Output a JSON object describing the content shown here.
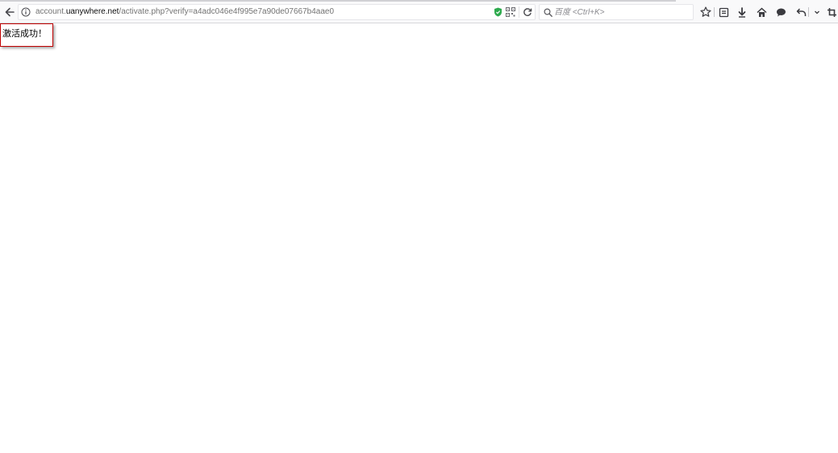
{
  "browser": {
    "url": {
      "prefix": "account.",
      "host": "uanywhere.net",
      "path": "/activate.php?verify=a4adc046e4f995e7a90de07667b4aae0"
    },
    "search": {
      "placeholder": "百度 <Ctrl+K>"
    },
    "icons": {
      "back": "back-arrow-icon",
      "info": "info-icon",
      "shield": "shield-icon",
      "qr": "qr-code-icon",
      "reload": "reload-icon",
      "search": "search-icon",
      "bookmark": "star-icon",
      "reading_list": "reading-list-icon",
      "downloads": "download-icon",
      "home": "home-icon",
      "chat": "chat-icon",
      "undo": "undo-icon",
      "menu": "chevron-down-icon",
      "crop": "crop-icon"
    },
    "colors": {
      "toolbar_bg": "#f9f9fa",
      "shield_green": "#2eaa4e"
    }
  },
  "page": {
    "message": "激活成功！",
    "highlight_color": "#c00000"
  }
}
